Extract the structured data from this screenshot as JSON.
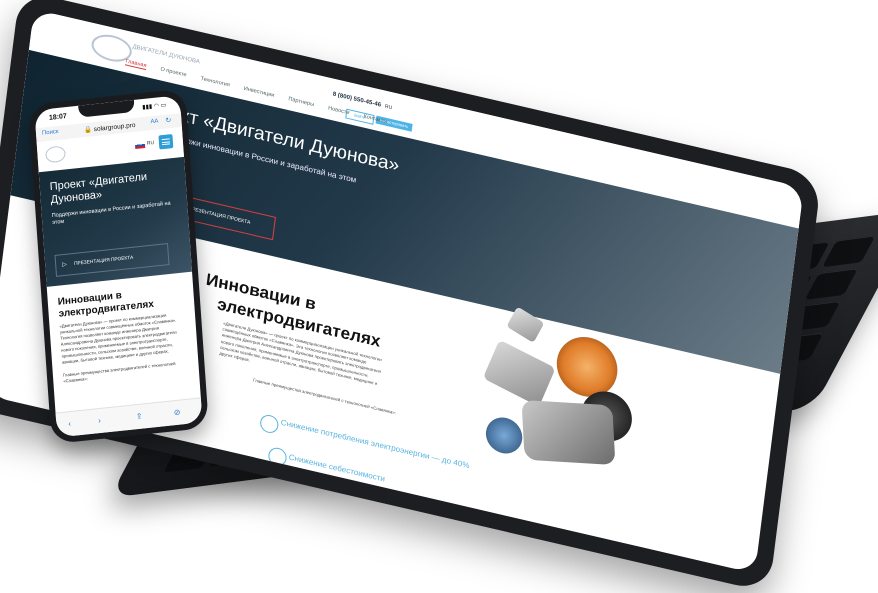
{
  "tablet": {
    "nav": {
      "logo_text": "ДВИГАТЕЛИ ДУЮНОВА",
      "phone": "8 (800) 550-45-46",
      "lang": "RU",
      "items": [
        "Главная",
        "О проекте",
        "Технология",
        "Инвестиции",
        "Партнеры",
        "Новости",
        "Контакты"
      ],
      "btn_login": "Войти",
      "btn_invest": "Инвестировать"
    },
    "hero": {
      "title": "Проект «Двигатели Дуюнова»",
      "subtitle": "Поддержи инновации в России и заработай на этом",
      "present_label": "ПРЕЗЕНТАЦИЯ ПРОЕКТА"
    },
    "section": {
      "title_line1": "Инновации в",
      "title_line2": "электродвигателях",
      "paragraph": "«Двигатели Дуюнова» — проект по коммерциализации уникальной технологии совмещённых обмоток «Славянка». Эта технология позволяет команде инженера Дмитрия Александровича Дуюнова проектировать электродвигатели нового поколения, применяемые в электротранспорте, промышленности, сельском хозяйстве, военной отрасли, авиации, бытовой технике, медицине и других сферах.",
      "paragraph2": "Главные преимущества электродвигателей с технологией «Славянка»:",
      "feature1": "Снижение потребления электроэнергии — до 40%",
      "feature2": "Снижение себестоимости"
    }
  },
  "phone": {
    "time": "18:07",
    "signal": "▮▮▮ ◠ ▭",
    "back": "Поиск",
    "url": "🔒 solargroup.pro",
    "aa": "АА",
    "reload": "↻",
    "lang": "RU",
    "hero": {
      "title": "Проект «Двигатели Дуюнова»",
      "subtitle": "Поддержи инновации в России и заработай на этом",
      "present_label": "ПРЕЗЕНТАЦИЯ ПРОЕКТА",
      "play": "▷"
    },
    "section": {
      "title": "Инновации в электродвигателях",
      "paragraph": "«Двигатели Дуюнова» — проект по коммерциализации уникальной технологии совмещённых обмоток «Славянка». Технология позволяет команде инженера Дмитрия Александровича Дуюнова проектировать электродвигатели нового поколения, применяемые в электротранспорте, промышленности, сельском хозяйстве, военной отрасли, авиации, бытовой технике, медицине и других сферах.",
      "paragraph2": "Главные преимущества электродвигателей с технологией «Славянка»:"
    },
    "toolbar": {
      "back": "‹",
      "forward": "›",
      "share": "⇪",
      "bookmarks": "⊘"
    }
  }
}
